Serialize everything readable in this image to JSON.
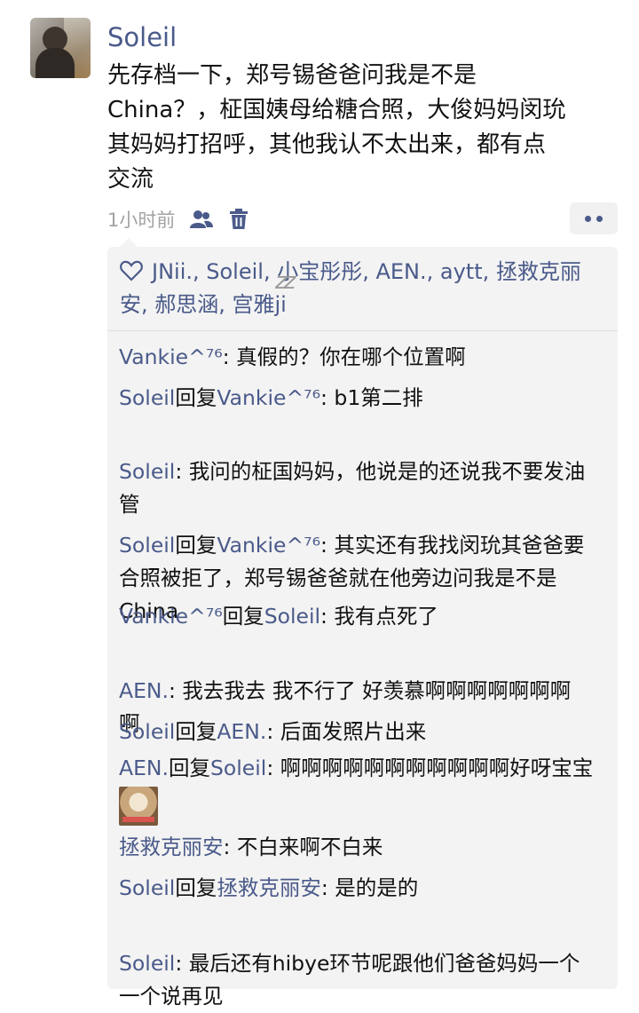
{
  "post": {
    "username": "Soleil",
    "text": "先存档一下，郑号锡爸爸问我是不是\nChina？，柾国姨母给糖合照，大俊妈妈闵玧\n其妈妈打招呼，其他我认不太出来，都有点\n交流",
    "timestamp": "1小时前"
  },
  "actions": {
    "visibility_icon": "friends-visible-icon",
    "delete_icon": "trash-icon",
    "more_icon": "more-dots-icon"
  },
  "likes": {
    "icon": "heart-outline-icon",
    "names": "JNii., Soleil, 小宝彤彤, AEN., aytt, 拯救克丽安, 郝思涵, 宫雅ji"
  },
  "overlay_mark": "zz",
  "comments": [
    {
      "name": "Vankie^⁷⁶",
      "reply_word": "",
      "reply_to": "",
      "text": ": 真假的？你在哪个位置啊"
    },
    {
      "name": "Soleil",
      "reply_word": "回复",
      "reply_to": "Vankie^⁷⁶",
      "text": ": b1第二排"
    },
    {
      "name": "Soleil",
      "reply_word": "",
      "reply_to": "",
      "text": ": 我问的柾国妈妈，他说是的还说我不要发油\n管"
    },
    {
      "name": "Soleil",
      "reply_word": "回复",
      "reply_to": "Vankie^⁷⁶",
      "text": ": 其实还有我找闵玧其爸爸要\n合照被拒了，郑号锡爸爸就在他旁边问我是不是\nChina"
    },
    {
      "name": "Vankie^⁷⁶",
      "reply_word": "回复",
      "reply_to": "Soleil",
      "text": ": 我有点死了"
    },
    {
      "name": "AEN.",
      "reply_word": "",
      "reply_to": "",
      "text": ": 我去我去 我不行了 好羡慕啊啊啊啊啊啊啊\n啊"
    },
    {
      "name": "Soleil",
      "reply_word": "回复",
      "reply_to": "AEN.",
      "text": ": 后面发照片出来"
    },
    {
      "name": "AEN.",
      "reply_word": "回复",
      "reply_to": "Soleil",
      "text": ": 啊啊啊啊啊啊啊啊啊啊啊好呀宝宝",
      "sticker": "dog-sticker"
    },
    {
      "name": "拯救克丽安",
      "reply_word": "",
      "reply_to": "",
      "text": ": 不白来啊不白来"
    },
    {
      "name": "Soleil",
      "reply_word": "回复",
      "reply_to": "拯救克丽安",
      "text": ": 是的是的"
    },
    {
      "name": "Soleil",
      "reply_word": "",
      "reply_to": "",
      "text": ": 最后还有hibye环节呢跟他们爸爸妈妈一个\n一个说再见"
    }
  ],
  "colors": {
    "link": "#4a5a8a",
    "panel": "#f3f3f3",
    "meta": "#a3a3a3"
  }
}
